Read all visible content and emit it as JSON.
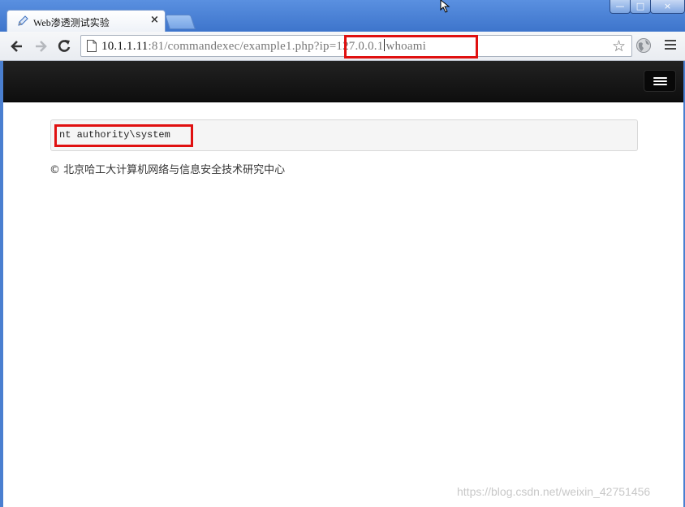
{
  "window": {
    "tab_title": "Web渗透测试实验",
    "tab_close": "×",
    "controls": {
      "minimize": "—",
      "maximize": "□",
      "close": "×"
    }
  },
  "toolbar": {
    "url_host": "10.1.1.11",
    "url_path": ":81/commandexec/example1.php?",
    "url_query_a": "ip=127.0.0.1",
    "url_query_b": "whoami"
  },
  "page": {
    "command_output": "nt authority\\system",
    "footer": "© 北京哈工大计算机网络与信息安全技术研究中心"
  },
  "watermark": "https://blog.csdn.net/weixin_42751456",
  "colors": {
    "highlight": "#e01010",
    "navbar": "#1a1a1a",
    "chrome_frame": "#4a7fd0"
  }
}
